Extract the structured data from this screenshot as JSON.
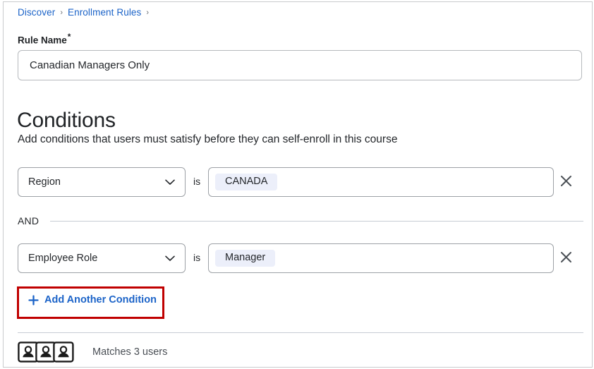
{
  "breadcrumb": {
    "items": [
      {
        "label": "Discover",
        "separator": "›"
      },
      {
        "label": "Enrollment Rules",
        "separator": "›"
      }
    ]
  },
  "rule_name": {
    "label": "Rule Name",
    "required_marker": "*",
    "value": "Canadian Managers Only",
    "placeholder": "Rule Name"
  },
  "conditions": {
    "title": "Conditions",
    "description": "Add conditions that users must satisfy before they can self-enroll in this course",
    "operator_label": "is",
    "joiner_label": "AND",
    "rows": [
      {
        "attribute": "Region",
        "operator": "is",
        "value_tag": "CANADA",
        "remove_icon": "close-icon",
        "chevron_icon": "chevron-down-icon"
      },
      {
        "attribute": "Employee Role",
        "operator": "is",
        "value_tag": "Manager",
        "remove_icon": "close-icon",
        "chevron_icon": "chevron-down-icon"
      }
    ],
    "add_button": {
      "label": "Add Another Condition",
      "icon": "plus-icon"
    }
  },
  "footer": {
    "users_icon": "users-group-icon",
    "match_text": "Matches 3 users"
  },
  "colors": {
    "link_blue": "#1b63c8",
    "annotation_red": "#c00000",
    "tag_background": "#eceffa",
    "border_grey": "#9da1a6",
    "text_primary": "#24272b",
    "divider": "#c6ccd4"
  }
}
